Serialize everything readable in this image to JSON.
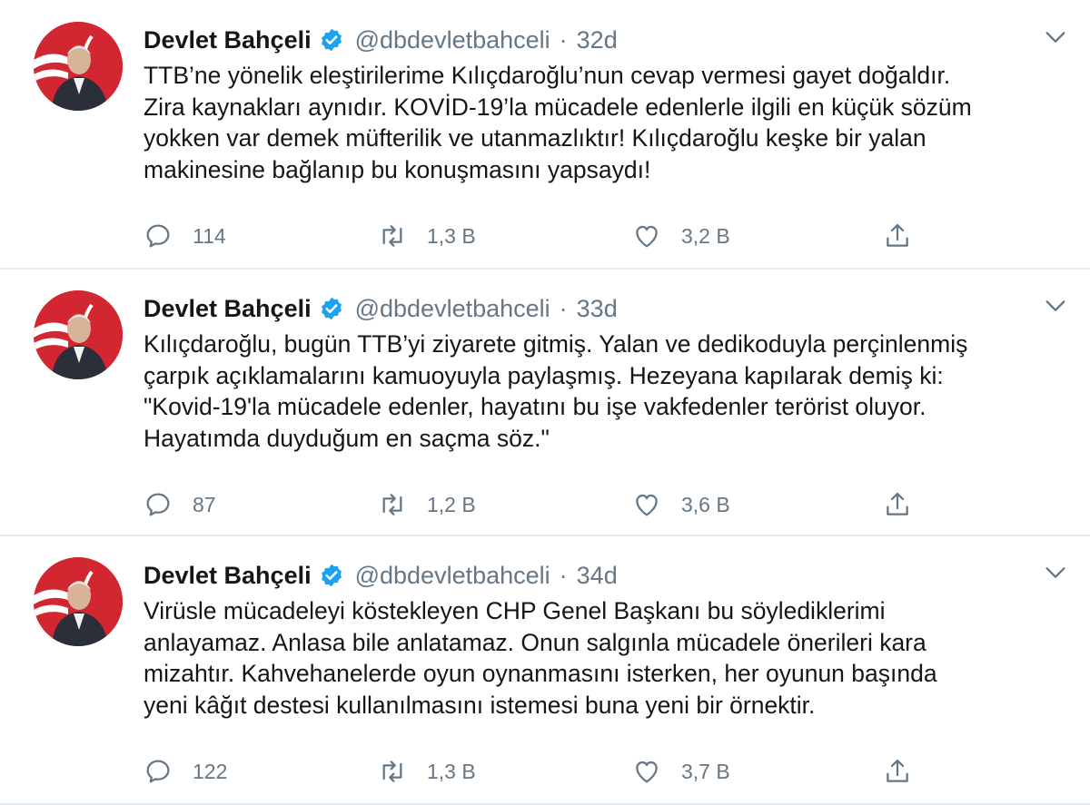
{
  "tweets": [
    {
      "author_name": "Devlet Bahçeli",
      "handle": "@dbdevletbahceli",
      "separator": "·",
      "time": "32d",
      "text": "TTB’ne yönelik eleştirilerime Kılıçdaroğlu’nun cevap vermesi gayet doğaldır.\nZira kaynakları aynıdır. KOVİD-19’la mücadele edenlerle ilgili en küçük sözüm\nyokken var demek müfterilik ve utanmazlıktır! Kılıçdaroğlu keşke bir yalan\nmakinesine bağlanıp bu konuşmasını yapsaydı!",
      "replies": "114",
      "retweets": "1,3 B",
      "likes": "3,2 B"
    },
    {
      "author_name": "Devlet Bahçeli",
      "handle": "@dbdevletbahceli",
      "separator": "·",
      "time": "33d",
      "text": "Kılıçdaroğlu, bugün TTB’yi ziyarete gitmiş. Yalan ve dedikoduyla perçinlenmiş\nçarpık açıklamalarını kamuoyuyla paylaşmış. Hezeyana kapılarak demiş ki:\n\"Kovid-19'la mücadele edenler, hayatını bu işe vakfedenler terörist oluyor.\nHayatımda duyduğum en saçma söz.\"",
      "replies": "87",
      "retweets": "1,2 B",
      "likes": "3,6 B"
    },
    {
      "author_name": "Devlet Bahçeli",
      "handle": "@dbdevletbahceli",
      "separator": "·",
      "time": "34d",
      "text": "Virüsle mücadeleyi köstekleyen CHP Genel Başkanı bu söylediklerimi\nanlayamaz. Anlasa bile anlatamaz. Onun salgınla mücadele önerileri kara\nmizahtır. Kahvehanelerde oyun oynanmasını isterken, her oyunun başında\nyeni kâğıt destesi kullanılmasını istemesi buna yeni bir örnektir.",
      "replies": "122",
      "retweets": "1,3 B",
      "likes": "3,7 B"
    }
  ],
  "icons": {
    "verified": "verified-badge-icon",
    "reply": "reply-icon",
    "retweet": "retweet-icon",
    "like": "heart-icon",
    "share": "share-icon",
    "more": "chevron-down-icon"
  },
  "colors": {
    "verified_blue": "#1da1f2",
    "secondary_text": "#657786",
    "primary_text": "#14171a",
    "divider": "#e6ecf0"
  }
}
